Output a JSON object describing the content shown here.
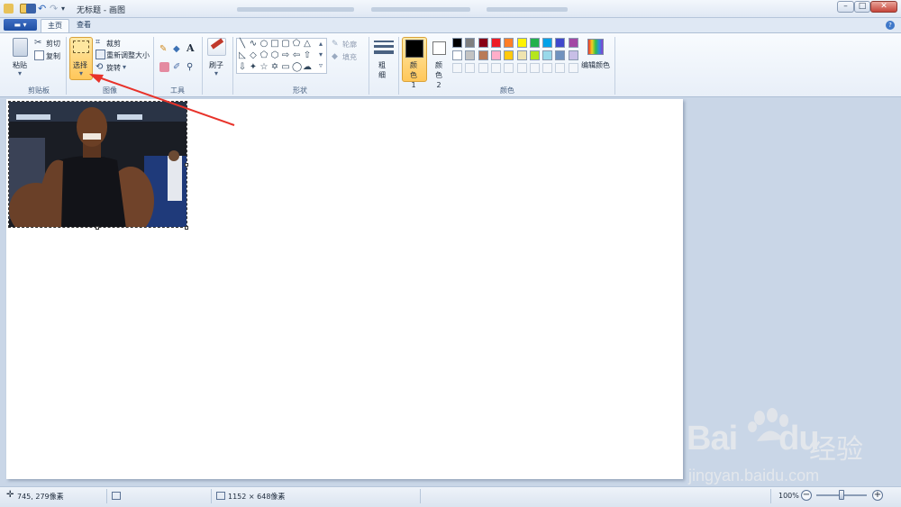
{
  "window": {
    "title": "无标题 - 画图",
    "buttons": {
      "minimize": "–",
      "maximize": "□",
      "close": "✕"
    }
  },
  "tabs": {
    "app_menu": "▾",
    "home": "主页",
    "view": "查看",
    "help": "?"
  },
  "clipboard": {
    "paste": "粘贴",
    "cut": "剪切",
    "copy": "复制",
    "label": "剪贴板"
  },
  "image": {
    "select": "选择",
    "crop": "裁剪",
    "resize": "重新调整大小",
    "rotate": "旋转",
    "label": "图像"
  },
  "tools": {
    "label": "工具",
    "text_tool": "A"
  },
  "brushes": {
    "label": "刷子"
  },
  "shapes": {
    "outline": "轮廓",
    "fill": "填充",
    "label": "形状"
  },
  "size": {
    "label": "粗细"
  },
  "colors": {
    "color1": "颜色 1",
    "color2": "颜色 2",
    "edit": "编辑颜色",
    "label": "颜色",
    "color1_value": "#000000",
    "color2_value": "#ffffff",
    "palette_row1": [
      "#000000",
      "#7f7f7f",
      "#880015",
      "#ed1c24",
      "#ff7f27",
      "#fff200",
      "#22b14c",
      "#00a2e8",
      "#3f48cc",
      "#a349a4"
    ],
    "palette_row2": [
      "#ffffff",
      "#c3c3c3",
      "#b97a57",
      "#ffaec9",
      "#ffc90e",
      "#efe4b0",
      "#b5e61d",
      "#99d9ea",
      "#7092be",
      "#c8bfe7"
    ]
  },
  "status": {
    "cursor": "745, 279像素",
    "image_size": "1152 × 648像素",
    "zoom": "100%",
    "zoom_level_percent": 100
  },
  "watermark": {
    "brand": "Bai",
    "brand2": "du",
    "cn": "经验",
    "url": "jingyan.baidu.com"
  }
}
